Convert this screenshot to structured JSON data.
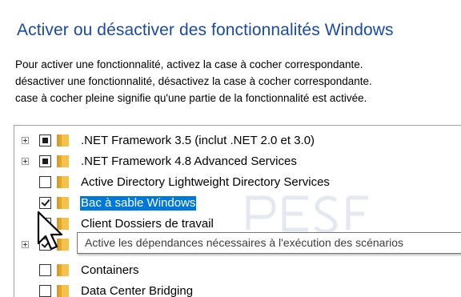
{
  "window": {
    "title": "Activer ou désactiver des fonctionnalités Windows"
  },
  "description": {
    "line1": "Pour activer une fonctionnalité, activez la case à cocher correspondante.",
    "line2": "désactiver une fonctionnalité, désactivez la case à cocher correspondante.",
    "line3": "case à cocher pleine signifie qu'une partie de la fonctionnalité est activée."
  },
  "features": [
    {
      "label": ".NET Framework 3.5 (inclut .NET 2.0 et 3.0)",
      "state": "partial",
      "expandable": true,
      "selected": false
    },
    {
      "label": ".NET Framework 4.8 Advanced Services",
      "state": "partial",
      "expandable": true,
      "selected": false
    },
    {
      "label": "Active Directory Lightweight Directory Services",
      "state": "unchecked",
      "expandable": false,
      "selected": false
    },
    {
      "label": "Bac à sable Windows",
      "state": "checked",
      "expandable": false,
      "selected": true
    },
    {
      "label": "Client Dossiers de travail",
      "state": "unchecked",
      "expandable": false,
      "selected": false
    },
    {
      "label": "",
      "state": "checked",
      "expandable": true,
      "selected": false
    },
    {
      "label": "Containers",
      "state": "unchecked",
      "expandable": false,
      "selected": false
    },
    {
      "label": "Data Center Bridging",
      "state": "unchecked",
      "expandable": false,
      "selected": false
    }
  ],
  "tooltip": {
    "text": "Active les dépendances nécessaires à l'exécution des scénarios"
  },
  "icons": {
    "folder": "folder-icon",
    "expand": "plus-expander-icon",
    "cursor": "arrow-cursor-icon"
  },
  "colors": {
    "title": "#1a4aa8",
    "selection": "#0078d7",
    "folder": "#e8b64a"
  }
}
